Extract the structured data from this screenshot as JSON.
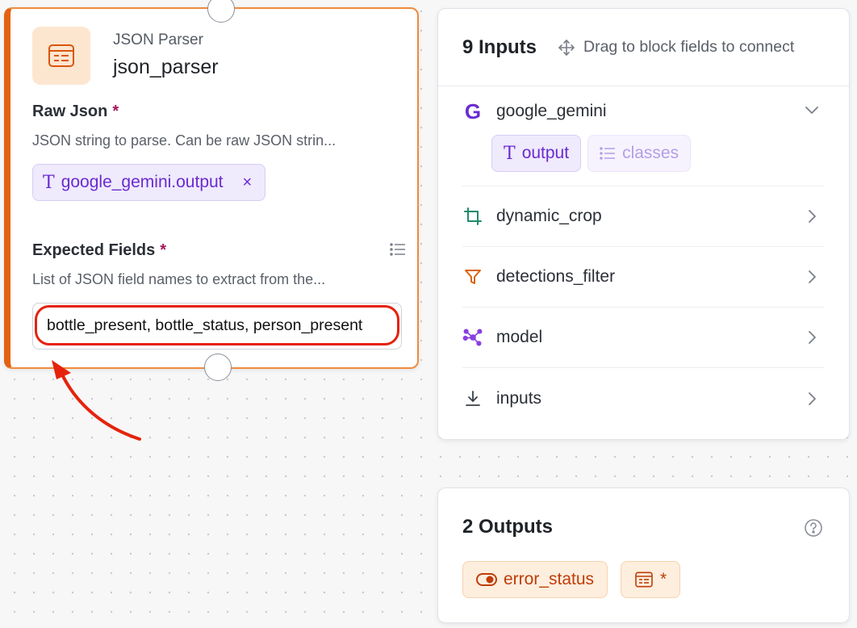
{
  "node": {
    "type_label": "JSON Parser",
    "name": "json_parser",
    "icon": "json-parser-icon",
    "raw_json": {
      "label": "Raw Json",
      "required": "*",
      "description": "JSON string to parse. Can be raw JSON strin...",
      "chip_label": "google_gemini.output",
      "chip_remove": "×"
    },
    "expected_fields": {
      "label": "Expected Fields",
      "required": "*",
      "description": "List of JSON field names to extract from the...",
      "value": "bottle_present, bottle_status, person_present"
    }
  },
  "inputs_panel": {
    "title": "9 Inputs",
    "drag_hint": "Drag to block fields to connect",
    "items": [
      {
        "label": "google_gemini",
        "icon": "gemini-g-icon",
        "expanded": true,
        "chips": [
          {
            "label": "output",
            "icon": "text-type-icon"
          },
          {
            "label": "classes",
            "icon": "list-icon"
          }
        ]
      },
      {
        "label": "dynamic_crop",
        "icon": "crop-icon"
      },
      {
        "label": "detections_filter",
        "icon": "filter-icon"
      },
      {
        "label": "model",
        "icon": "model-graph-icon"
      },
      {
        "label": "inputs",
        "icon": "download-icon"
      }
    ],
    "chip_text_glyph": "T",
    "gemini_glyph": "G"
  },
  "outputs_panel": {
    "title": "2 Outputs",
    "chips": [
      {
        "label": "error_status",
        "icon": "toggle-icon"
      },
      {
        "label": "*",
        "icon": "json-parser-icon"
      }
    ]
  },
  "colors": {
    "accent_orange": "#e3620f",
    "purple": "#6a2bd1",
    "highlight_red": "#e5230c"
  }
}
